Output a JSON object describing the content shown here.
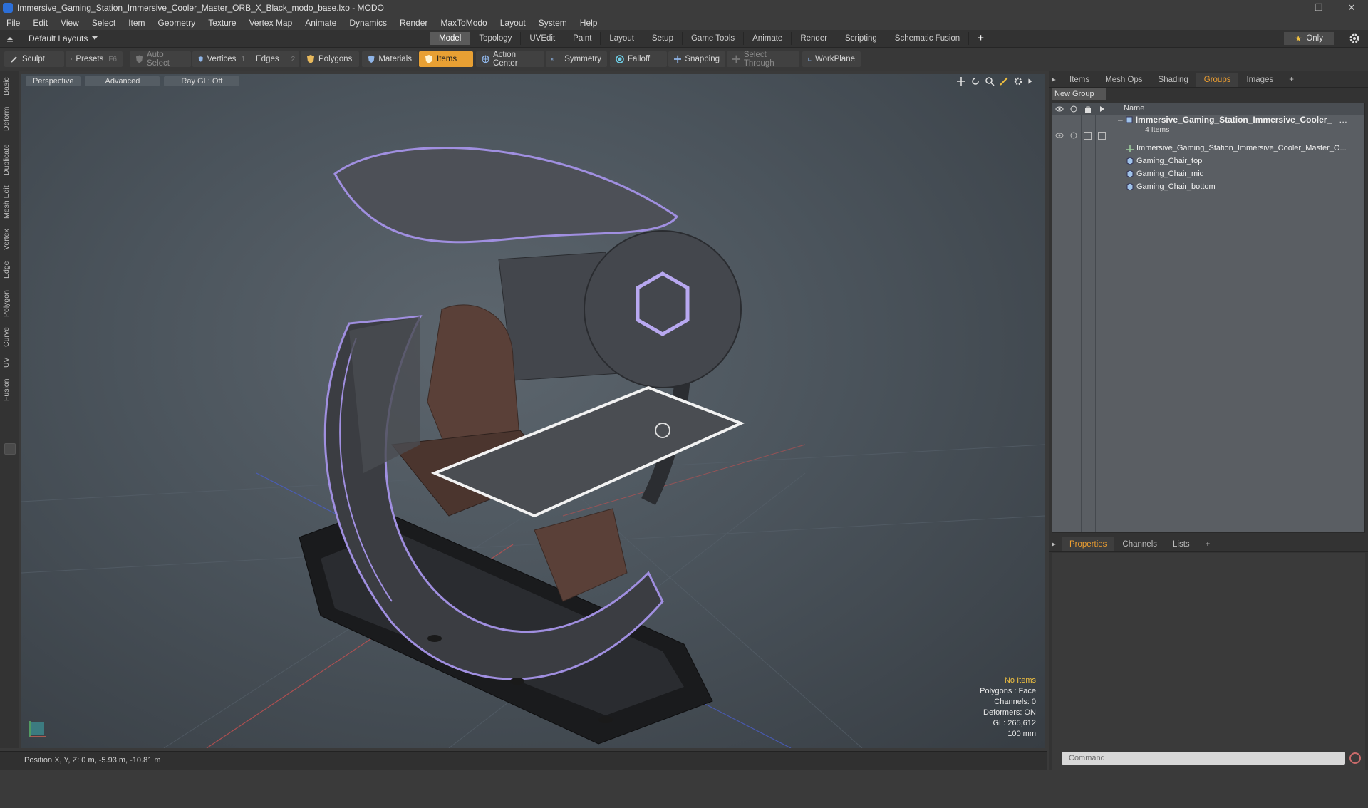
{
  "window": {
    "title": "Immersive_Gaming_Station_Immersive_Cooler_Master_ORB_X_Black_modo_base.lxo - MODO",
    "controls": [
      "–",
      "❐",
      "✕"
    ]
  },
  "menu": [
    "File",
    "Edit",
    "View",
    "Select",
    "Item",
    "Geometry",
    "Texture",
    "Vertex Map",
    "Animate",
    "Dynamics",
    "Render",
    "MaxToModo",
    "Layout",
    "System",
    "Help"
  ],
  "layout_select": "Default Layouts",
  "mode_tabs": [
    "Model",
    "Topology",
    "UVEdit",
    "Paint",
    "Layout",
    "Setup",
    "Game Tools",
    "Animate",
    "Render",
    "Scripting",
    "Schematic Fusion"
  ],
  "active_mode_tab": "Model",
  "only_label": "Only",
  "toolbar": {
    "sculpt": "Sculpt",
    "presets": "Presets",
    "presets_shortcut": "F6",
    "auto_select": "Auto Select",
    "vertices": "Vertices",
    "vertices_count": "1",
    "edges": "Edges",
    "edges_count": "2",
    "polygons": "Polygons",
    "materials": "Materials",
    "items": "Items",
    "action_center": "Action Center",
    "symmetry": "Symmetry",
    "falloff": "Falloff",
    "snapping": "Snapping",
    "select_through": "Select Through",
    "workplane": "WorkPlane"
  },
  "left_tabs": [
    "Basic",
    "Deform",
    "Duplicate",
    "Mesh Edit",
    "Vertex",
    "Edge",
    "Polygon",
    "Curve",
    "UV",
    "Fusion"
  ],
  "viewport": {
    "view": "Perspective",
    "shading": "Advanced",
    "raygl": "Ray GL: Off",
    "stats": {
      "selection": "No Items",
      "polygons": "Polygons : Face",
      "channels": "Channels: 0",
      "deformers": "Deformers: ON",
      "gl": "GL: 265,612",
      "scale": "100 mm"
    }
  },
  "status": {
    "position": "Position X, Y, Z:  0 m, -5.93 m, -10.81 m"
  },
  "right_panel": {
    "top_tabs": [
      "Items",
      "Mesh Ops",
      "Shading",
      "Groups",
      "Images"
    ],
    "active_top_tab": "Groups",
    "new_group": "New Group",
    "column_name": "Name",
    "group": {
      "name": "Immersive_Gaming_Station_Immersive_Cooler_",
      "count": "4 Items",
      "children": [
        "Immersive_Gaming_Station_Immersive_Cooler_Master_O...",
        "Gaming_Chair_top",
        "Gaming_Chair_mid",
        "Gaming_Chair_bottom"
      ]
    },
    "bottom_tabs": [
      "Properties",
      "Channels",
      "Lists"
    ],
    "active_bottom_tab": "Properties"
  },
  "command_placeholder": "Command",
  "colors": {
    "accent": "#e8a033",
    "tab_active_text": "#f0a030",
    "viewport_bg": "#4b545c",
    "model_outline": "#9a86d8"
  }
}
